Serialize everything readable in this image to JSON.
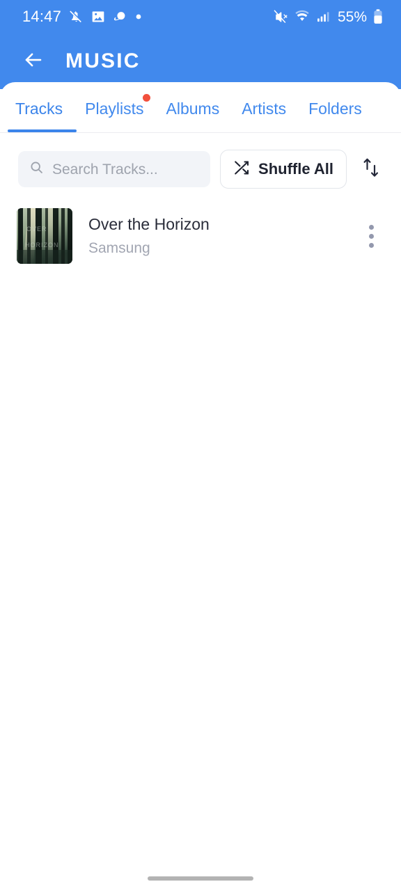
{
  "status_bar": {
    "clock": "14:47",
    "battery_percent": "55%",
    "left_icons": [
      "alarm-muted-icon",
      "gallery-image-icon",
      "saturn-planet-icon",
      "more-notifications-dot-icon"
    ],
    "right_icons": [
      "volume-muted-icon",
      "wifi-icon",
      "cellular-signal-icon",
      "battery-icon"
    ]
  },
  "app_bar": {
    "back_icon": "arrow-left-icon",
    "title": "MUSIC"
  },
  "tabs": {
    "active_index": 0,
    "items": [
      {
        "label": "Tracks",
        "badge": false
      },
      {
        "label": "Playlists",
        "badge": true
      },
      {
        "label": "Albums",
        "badge": false
      },
      {
        "label": "Artists",
        "badge": false
      },
      {
        "label": "Folders",
        "badge": false
      }
    ]
  },
  "controls": {
    "search": {
      "icon": "search-icon",
      "value": "",
      "placeholder": "Search Tracks..."
    },
    "shuffle": {
      "icon": "shuffle-icon",
      "label": "Shuffle All"
    },
    "sort": {
      "icon": "sort-arrows-icon"
    }
  },
  "track_list": {
    "tracks": [
      {
        "title": "Over the Horizon",
        "artist": "Samsung",
        "artwork": "forest-light-rays-album-art",
        "menu_icon": "more-vertical-icon"
      }
    ]
  },
  "colors": {
    "header_blue": "#4189ED",
    "accent_blue": "#3B84EA",
    "badge_red": "#F2503C",
    "title_text": "#2A2D3A",
    "secondary_text": "#A2A6B2",
    "search_bg": "#F2F4F8",
    "home_indicator": "#B3B3B3"
  },
  "navigation": {
    "home_indicator": "home-indicator"
  }
}
